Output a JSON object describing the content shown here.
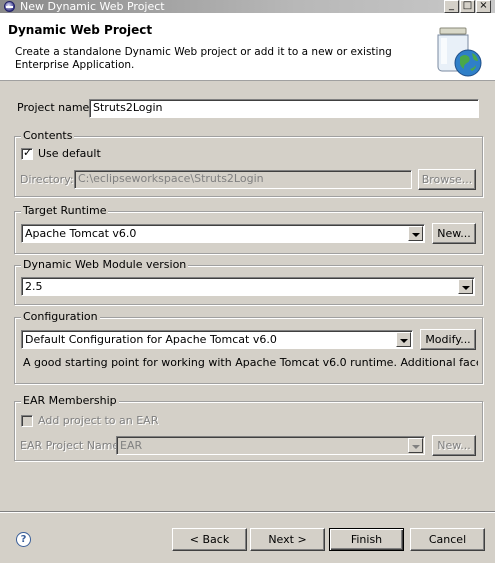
{
  "window": {
    "title": "New Dynamic Web Project"
  },
  "banner": {
    "title": "Dynamic Web Project",
    "description": "Create a standalone Dynamic Web project or add it to a new or existing Enterprise Application."
  },
  "project_name": {
    "label": "Project name:",
    "value": "Struts2Login"
  },
  "contents": {
    "title": "Contents",
    "use_default_label": "Use default",
    "use_default_checked": true,
    "directory_label": "Directory:",
    "directory_value": "C:\\eclipseworkspace\\Struts2Login",
    "browse_label": "Browse..."
  },
  "target_runtime": {
    "title": "Target Runtime",
    "selected": "Apache Tomcat v6.0",
    "new_label": "New..."
  },
  "module_version": {
    "title": "Dynamic Web Module version",
    "selected": "2.5"
  },
  "configuration": {
    "title": "Configuration",
    "selected": "Default Configuration for Apache Tomcat v6.0",
    "modify_label": "Modify...",
    "description": "A good starting point for working with Apache Tomcat v6.0 runtime. Additional facets can"
  },
  "ear": {
    "title": "EAR Membership",
    "add_label": "Add project to an EAR",
    "add_checked": false,
    "project_name_label": "EAR Project Name:",
    "project_name_value": "EAR",
    "new_label": "New..."
  },
  "footer": {
    "help_symbol": "?",
    "back_label": "< Back",
    "next_label": "Next >",
    "finish_label": "Finish",
    "cancel_label": "Cancel"
  },
  "icons": {
    "window_minimize": "_",
    "window_maximize": "□",
    "window_close": "×"
  }
}
